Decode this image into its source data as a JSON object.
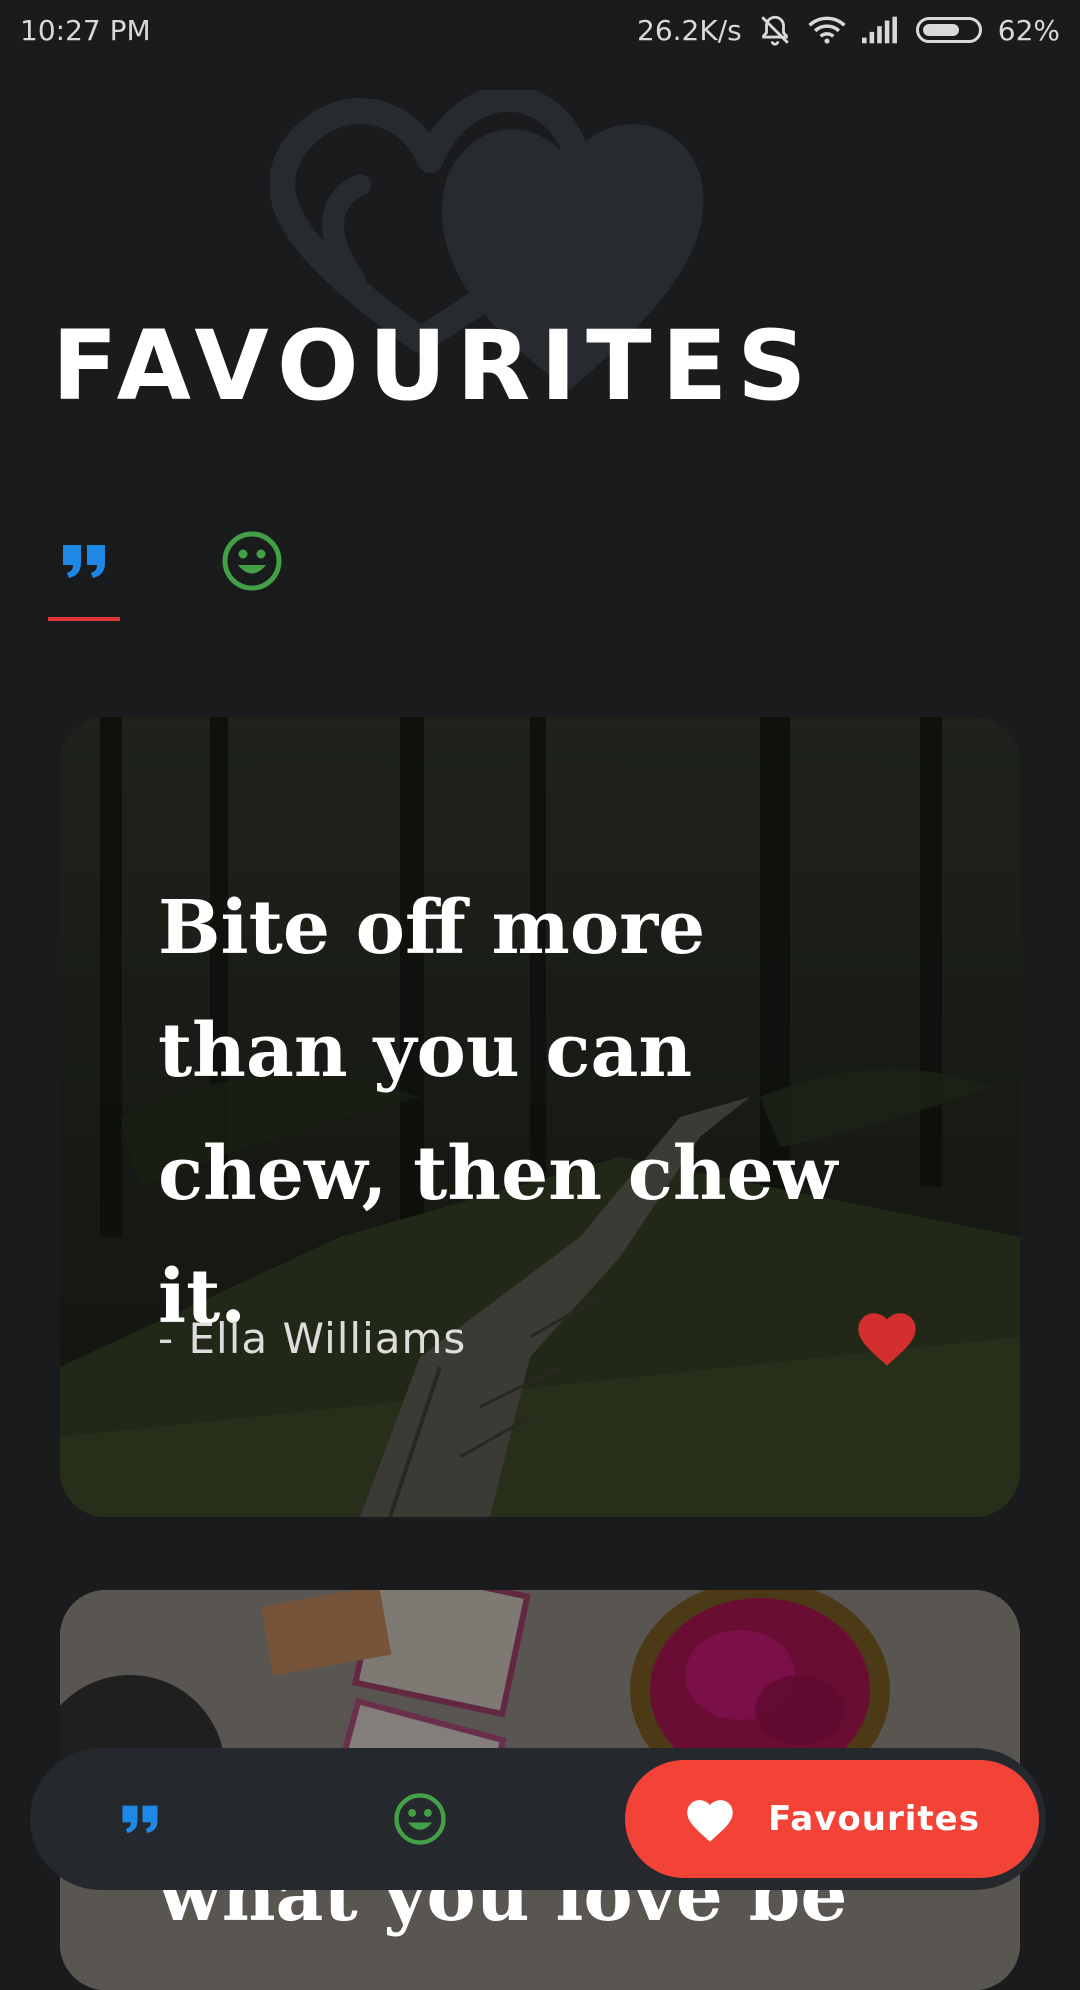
{
  "status_bar": {
    "time": "10:27 PM",
    "network_speed": "26.2K/s",
    "battery": "62%",
    "battery_level": 0.62,
    "icons": [
      "mute-alarm-icon",
      "wifi-icon",
      "signal-icon",
      "battery-icon"
    ]
  },
  "header": {
    "title": "FAVOURITES",
    "art_icon": "two-hearts-icon"
  },
  "tabs": [
    {
      "name": "quotes",
      "icon": "quote-icon",
      "active": true
    },
    {
      "name": "jokes",
      "icon": "smiley-icon",
      "active": false
    }
  ],
  "cards": [
    {
      "quote": "Bite off more than you can chew, then chew it.",
      "author": "- Ella Williams",
      "favourited": true
    },
    {
      "quote": "what you love be"
    }
  ],
  "bottom_nav": {
    "items": [
      {
        "icon": "quote-icon"
      },
      {
        "icon": "smiley-icon"
      },
      {
        "icon": "heart-icon",
        "label": "Favourites",
        "active": true
      }
    ]
  },
  "colors": {
    "background": "#1a1b1d",
    "accent_red": "#f24336",
    "quote_blue": "#1e88e5",
    "smiley_green": "#43a047",
    "tab_indicator": "#e03838"
  }
}
